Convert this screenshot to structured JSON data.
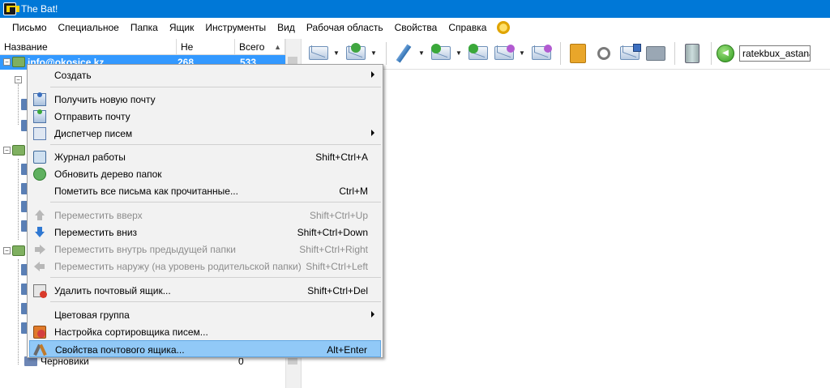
{
  "window": {
    "title": "The Bat!"
  },
  "menubar": [
    "Письмо",
    "Специальное",
    "Папка",
    "Ящик",
    "Инструменты",
    "Вид",
    "Рабочая область",
    "Свойства",
    "Справка"
  ],
  "tree": {
    "headers": {
      "name": "Название",
      "unread": "Не прочита...",
      "total": "Всего"
    },
    "account_row": {
      "name": "info@okosice.kz",
      "unread": "268",
      "total": "533"
    },
    "drafts": {
      "label": "Черновики",
      "count": "0"
    }
  },
  "toolbar": {
    "search_value": "ratekbux_astana"
  },
  "context_menu": {
    "items": [
      {
        "label": "Создать",
        "shortcut": "",
        "submenu": true,
        "disabled": false,
        "icon": "none"
      },
      {
        "label": "Получить новую почту",
        "shortcut": "",
        "submenu": false,
        "disabled": false,
        "icon": "get-mail-icon"
      },
      {
        "label": "Отправить почту",
        "shortcut": "",
        "submenu": false,
        "disabled": false,
        "icon": "send-mail-icon"
      },
      {
        "label": "Диспетчер писем",
        "shortcut": "",
        "submenu": true,
        "disabled": false,
        "icon": "dispatcher-icon"
      },
      {
        "label": "Журнал работы",
        "shortcut": "Shift+Ctrl+A",
        "submenu": false,
        "disabled": false,
        "icon": "log-icon"
      },
      {
        "label": "Обновить дерево папок",
        "shortcut": "",
        "submenu": false,
        "disabled": false,
        "icon": "refresh-icon"
      },
      {
        "label": "Пометить все письма как прочитанные...",
        "shortcut": "Ctrl+M",
        "submenu": false,
        "disabled": false,
        "icon": "none"
      },
      {
        "label": "Переместить вверх",
        "shortcut": "Shift+Ctrl+Up",
        "submenu": false,
        "disabled": true,
        "icon": "arrow-up-icon"
      },
      {
        "label": "Переместить вниз",
        "shortcut": "Shift+Ctrl+Down",
        "submenu": false,
        "disabled": false,
        "icon": "arrow-down-icon"
      },
      {
        "label": "Переместить внутрь предыдущей папки",
        "shortcut": "Shift+Ctrl+Right",
        "submenu": false,
        "disabled": true,
        "icon": "arrow-right-icon"
      },
      {
        "label": "Переместить наружу (на уровень родительской папки)",
        "shortcut": "Shift+Ctrl+Left",
        "submenu": false,
        "disabled": true,
        "icon": "arrow-left-icon"
      },
      {
        "label": "Удалить почтовый ящик...",
        "shortcut": "Shift+Ctrl+Del",
        "submenu": false,
        "disabled": false,
        "icon": "delete-mailbox-icon"
      },
      {
        "label": "Цветовая группа",
        "shortcut": "",
        "submenu": true,
        "disabled": false,
        "icon": "none"
      },
      {
        "label": "Настройка сортировщика писем...",
        "shortcut": "",
        "submenu": false,
        "disabled": false,
        "icon": "sorter-icon"
      },
      {
        "label": "Свойства почтового ящика...",
        "shortcut": "Alt+Enter",
        "submenu": false,
        "disabled": false,
        "icon": "properties-icon",
        "highlighted": true
      }
    ]
  },
  "colors": {
    "titlebar": "#0078d7",
    "selection": "#3399ff",
    "menu_highlight": "#91c9f7"
  }
}
